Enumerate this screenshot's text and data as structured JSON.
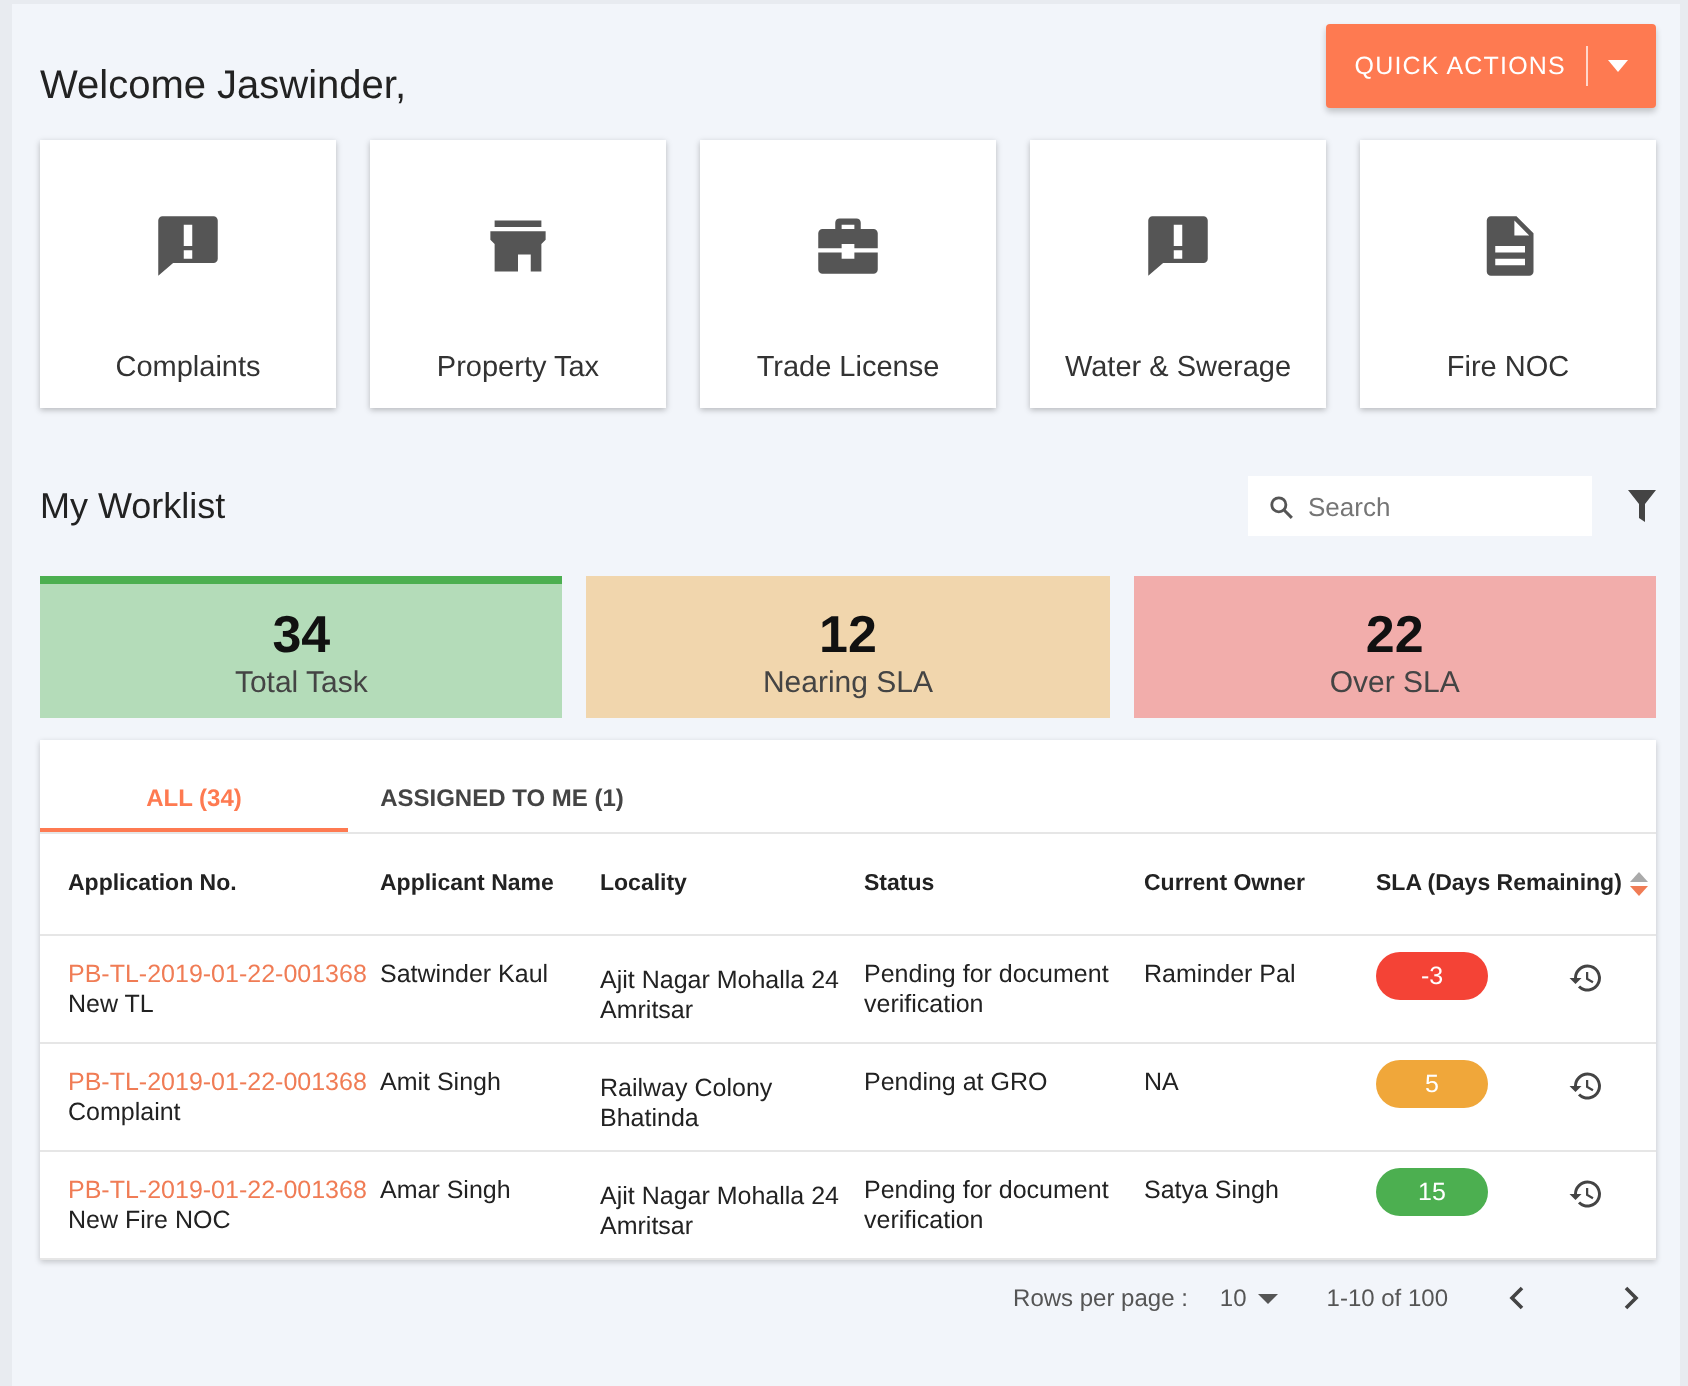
{
  "greeting": "Welcome Jaswinder,",
  "quick_actions": {
    "label": "QUICK ACTIONS"
  },
  "modules": [
    {
      "label": "Complaints"
    },
    {
      "label": "Property Tax"
    },
    {
      "label": "Trade License"
    },
    {
      "label": "Water & Swerage"
    },
    {
      "label": "Fire NOC"
    }
  ],
  "worklist": {
    "title": "My Worklist",
    "search": {
      "placeholder": "Search"
    }
  },
  "stats": [
    {
      "value": "34",
      "label": "Total Task",
      "color": "#b4dcb9",
      "selected": true
    },
    {
      "value": "12",
      "label": "Nearing SLA",
      "color": "#f1d6ad",
      "selected": false
    },
    {
      "value": "22",
      "label": "Over SLA",
      "color": "#f2adab",
      "selected": false
    }
  ],
  "tabs": [
    {
      "label": "ALL (34)",
      "selected": true
    },
    {
      "label": "ASSIGNED TO ME (1)",
      "selected": false
    }
  ],
  "table": {
    "columns": [
      "Application No.",
      "Applicant Name",
      "Locality",
      "Status",
      "Current Owner",
      "SLA (Days Remaining)"
    ],
    "rows": [
      {
        "application_no": "PB-TL-2019-01-22-001368",
        "type": "New TL",
        "applicant": "Satwinder Kaul",
        "locality": [
          "Ajit Nagar Mohalla 24",
          "Amritsar"
        ],
        "status": "Pending for document verification",
        "owner": "Raminder Pal",
        "sla": "-3",
        "color": "#f44336"
      },
      {
        "application_no": "PB-TL-2019-01-22-001368",
        "type": "Complaint",
        "applicant": "Amit Singh",
        "locality": [
          "Railway Colony",
          "Bhatinda"
        ],
        "status": "Pending at GRO",
        "owner": "NA",
        "sla": "5",
        "color": "#f0a73a"
      },
      {
        "application_no": "PB-TL-2019-01-22-001368",
        "type": "New Fire NOC",
        "applicant": "Amar Singh",
        "locality": [
          "Ajit Nagar Mohalla 24",
          "Amritsar"
        ],
        "status": "Pending for document verification",
        "owner": "Satya Singh",
        "sla": "15",
        "color": "#4caf50"
      }
    ]
  },
  "pagination": {
    "rows_per_page_label": "Rows per page :",
    "rows_per_page": "10",
    "range": "1-10 of 100"
  }
}
